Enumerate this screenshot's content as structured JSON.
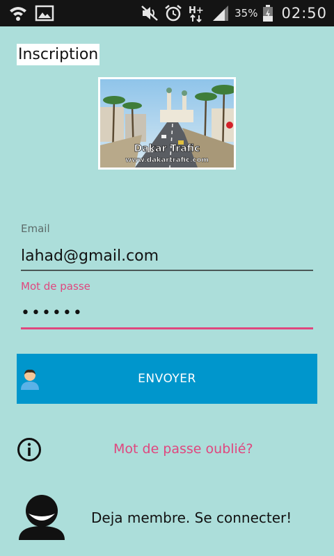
{
  "status_bar": {
    "icons_left": [
      "wifi-icon",
      "image-icon"
    ],
    "icons_right": [
      "mute-icon",
      "alarm-icon",
      "data-hplus-icon",
      "signal-icon",
      "battery-icon"
    ],
    "network_type": "H+",
    "battery_percent": "35%",
    "time": "02:50"
  },
  "page": {
    "title": "Inscription"
  },
  "banner": {
    "brand_line": "Dakar Trafic",
    "url_line": "www.dakartrafic.com"
  },
  "form": {
    "email_label": "Email",
    "email_value": "lahad@gmail.com",
    "password_label": "Mot de passe",
    "password_value": "••••••"
  },
  "actions": {
    "send_label": "ENVOYER",
    "forgot_label": "Mot de passe oublié?",
    "member_label": "Deja membre. Se connecter!"
  },
  "colors": {
    "background": "#acdeda",
    "status_bar": "#141414",
    "accent_pink": "#e0467e",
    "button_blue": "#0096cc"
  }
}
